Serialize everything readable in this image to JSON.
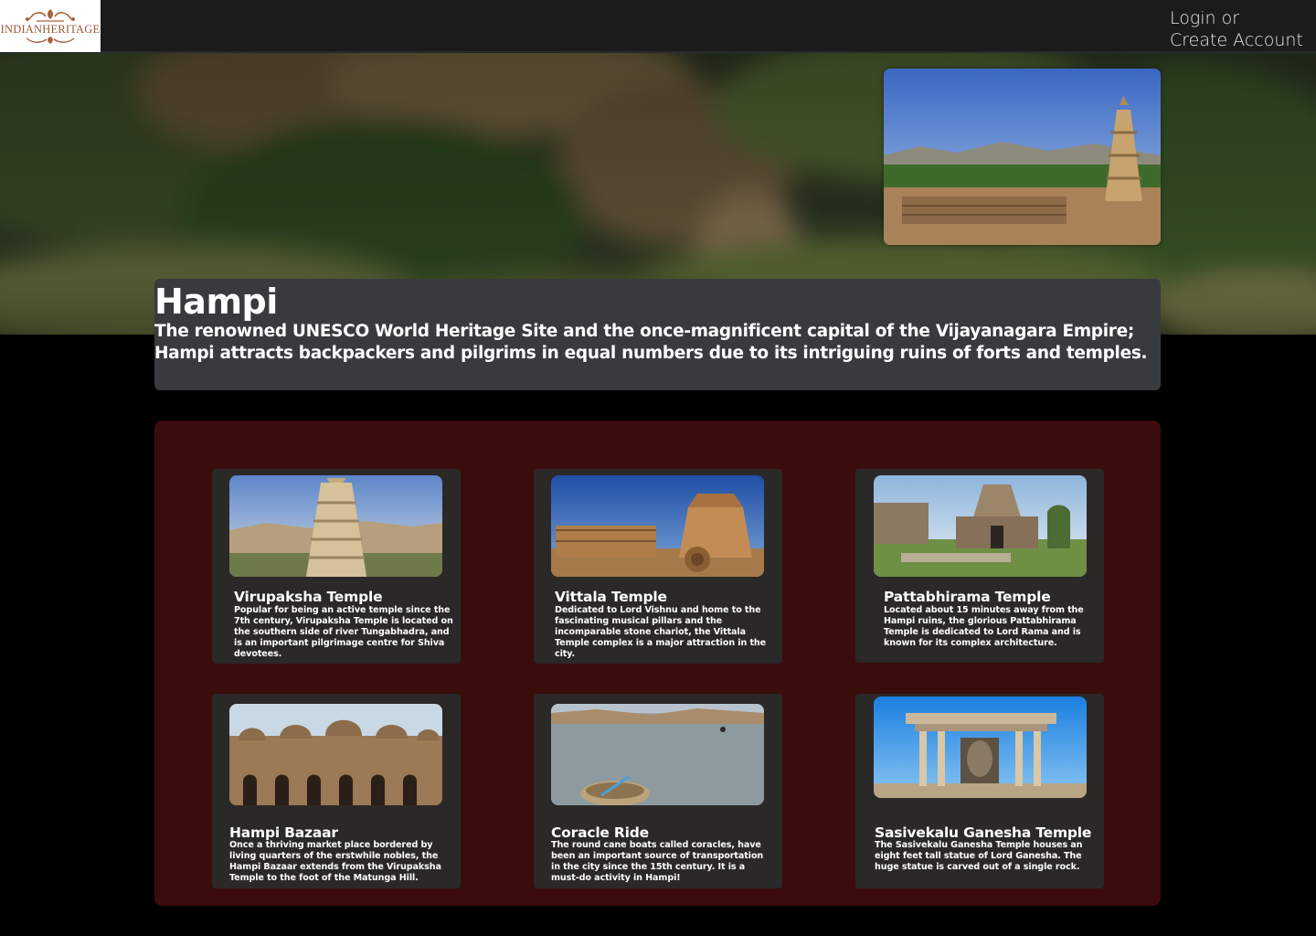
{
  "brand": {
    "logo_text": "INDIANHERITAGE",
    "logo_color": "#9b5a38"
  },
  "auth": {
    "login_label": "Login or",
    "create_label": "Create Account"
  },
  "intro": {
    "title": "Hampi",
    "description": "The renowned UNESCO World Heritage Site and the once-magnificent capital of the Vijayanagara Empire; Hampi attracts backpackers and pilgrims in equal numbers due to its intriguing ruins of forts and temples."
  },
  "attractions": [
    {
      "title": "Virupaksha Temple",
      "description": "Popular for being an active temple since the 7th century, Virupaksha Temple is located on the southern side of river Tungabhadra, and is an important pilgrimage centre for Shiva devotees."
    },
    {
      "title": "Vittala Temple",
      "description": "Dedicated to Lord Vishnu and home to the fascinating musical pillars and the incomparable stone chariot, the Vittala Temple complex is a major attraction in the city."
    },
    {
      "title": "Pattabhirama Temple",
      "description": "Located about 15 minutes away from the Hampi ruins, the glorious Pattabhirama Temple is dedicated to Lord Rama and is known for its complex architecture."
    },
    {
      "title": "Hampi Bazaar",
      "description": "Once a thriving market place bordered by living quarters of the erstwhile nobles, the Hampi Bazaar extends from the Virupaksha Temple to the foot of the Matunga Hill."
    },
    {
      "title": "Coracle Ride",
      "description": "The round cane boats called coracles, have been an important source of transportation in the city since the 15th century. It is a must-do activity in Hampi!"
    },
    {
      "title": "Sasivekalu Ganesha Temple",
      "description": "The Sasivekalu Ganesha Temple houses an eight feet tall statue of Lord Ganesha. The huge statue is carved out of a single rock."
    }
  ],
  "colors": {
    "topbar": "#1b1b1b",
    "intro_box": "#383b3d",
    "panel": "#3a0c0c",
    "card": "#2b2828"
  }
}
